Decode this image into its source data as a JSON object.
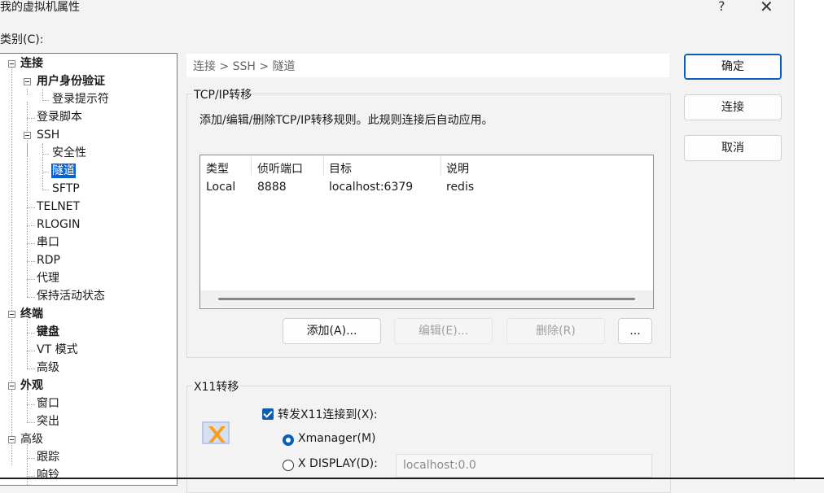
{
  "window": {
    "title": "我的虚拟机属性",
    "help": "?",
    "close": "✕"
  },
  "category_label": "类别(C):",
  "tree": {
    "connection": "连接",
    "user_auth": "用户身份验证",
    "login_prompt": "登录提示符",
    "login_script": "登录脚本",
    "ssh": "SSH",
    "security": "安全性",
    "tunnel": "隧道",
    "sftp": "SFTP",
    "telnet": "TELNET",
    "rlogin": "RLOGIN",
    "serial": "串口",
    "rdp": "RDP",
    "proxy": "代理",
    "keepalive": "保持活动状态",
    "terminal": "终端",
    "keyboard": "键盘",
    "vt_mode": "VT 模式",
    "advanced_term": "高级",
    "appearance": "外观",
    "window": "窗口",
    "highlight": "突出",
    "advanced": "高级",
    "trace": "跟踪",
    "bell": "响铃"
  },
  "breadcrumb": "连接 > SSH > 隧道",
  "tcpip": {
    "group_label": "TCP/IP转移",
    "description": "添加/编辑/删除TCP/IP转移规则。此规则连接后自动应用。",
    "columns": [
      "类型",
      "侦听端口",
      "目标",
      "说明"
    ],
    "rows": [
      {
        "type": "Local",
        "port": "8888",
        "target": "localhost:6379",
        "note": "redis"
      }
    ],
    "add_label": "添加(A)...",
    "edit_label": "编辑(E)...",
    "delete_label": "删除(R)",
    "more_label": "..."
  },
  "x11": {
    "group_label": "X11转移",
    "forward_label": "转发X11连接到(X):",
    "forward_checked": true,
    "xmanager_label": "Xmanager(M)",
    "xdisplay_label": "X DISPLAY(D):",
    "xdisplay_value": "localhost:0.0",
    "icon": "xmanager-icon"
  },
  "buttons": {
    "ok": "确定",
    "connect": "连接",
    "cancel": "取消"
  },
  "colors": {
    "accent": "#0a5fb4",
    "selection": "#0a64d0"
  }
}
